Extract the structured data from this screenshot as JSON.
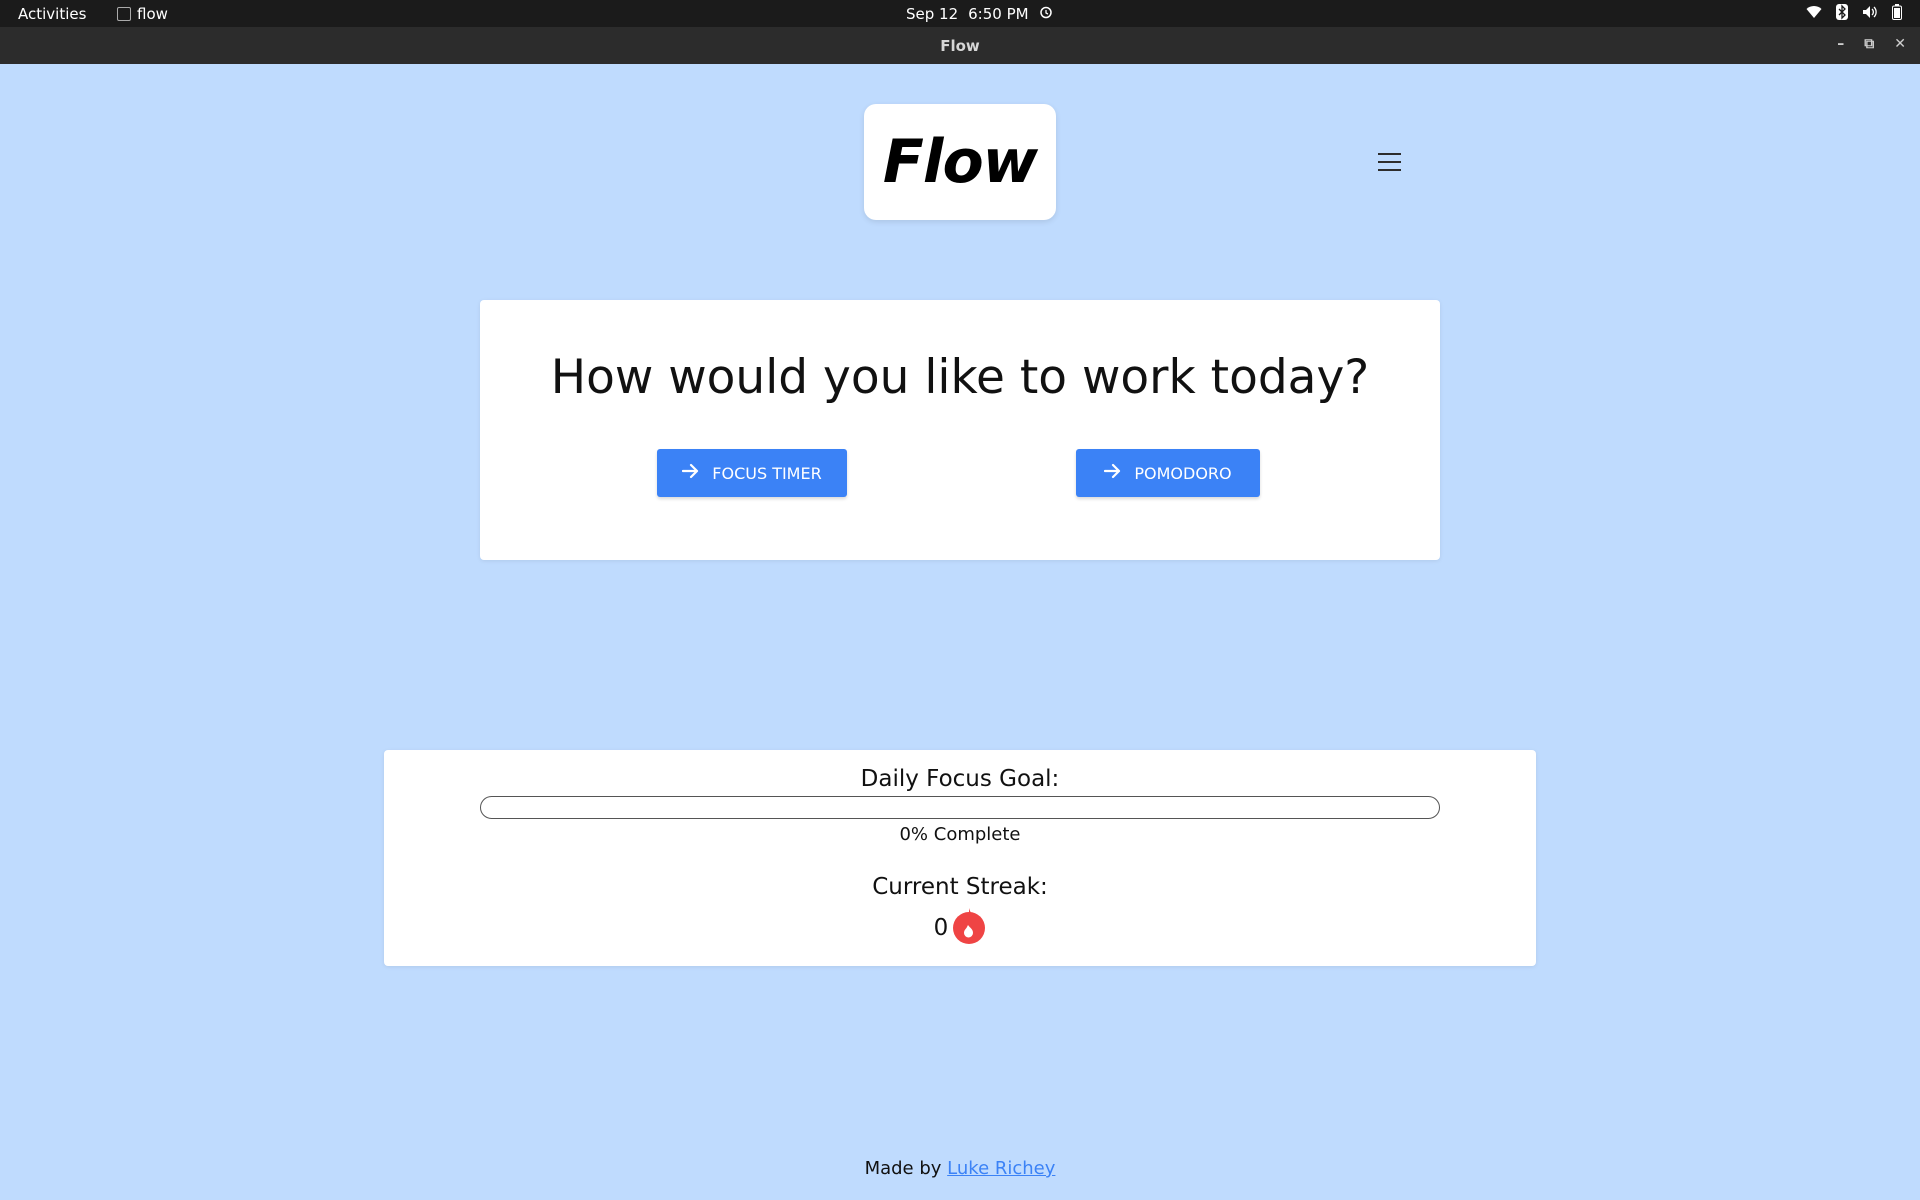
{
  "system_bar": {
    "activities": "Activities",
    "app_name": "flow",
    "date": "Sep 12",
    "time": "6:50 PM"
  },
  "window": {
    "title": "Flow"
  },
  "header": {
    "logo": "Flow",
    "menu_icon": "hamburger-menu-icon"
  },
  "choice": {
    "heading": "How would you like to work today?",
    "focus_timer_label": "FOCUS TIMER",
    "pomodoro_label": "POMODORO",
    "button_icon": "arrow-right-icon"
  },
  "goal": {
    "title": "Daily Focus Goal:",
    "progress_percent": 0,
    "progress_text": "0% Complete",
    "streak_title": "Current Streak:",
    "streak_count": "0",
    "streak_icon": "flame-icon"
  },
  "footer": {
    "made_by": "Made by",
    "author": "Luke Richey"
  },
  "colors": {
    "background": "#bfdbfe",
    "accent": "#3b82f6",
    "flame": "#ef4444"
  }
}
